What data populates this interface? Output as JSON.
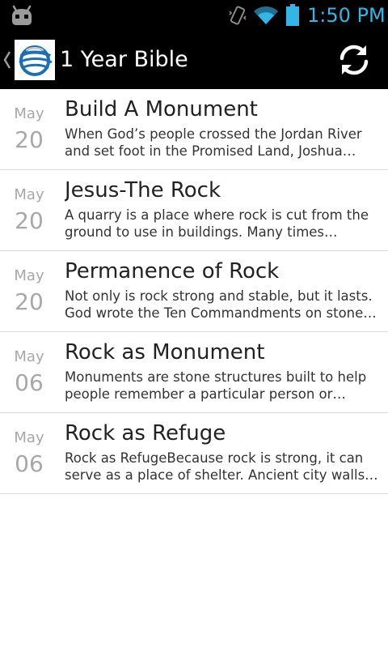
{
  "status_bar": {
    "time": "1:50 PM",
    "icons": [
      "cyanogenmod-robot-icon",
      "vibrate-icon",
      "wifi-icon",
      "battery-icon"
    ]
  },
  "action_bar": {
    "title": "1 Year Bible",
    "icons": [
      "up-caret-icon",
      "app-logo-icon",
      "refresh-icon"
    ]
  },
  "entries": [
    {
      "month": "May",
      "day": "20",
      "title": "Build A Monument",
      "summary": "When God’s people crossed the Jordan River and set foot in the Promised Land, Joshua asked…"
    },
    {
      "month": "May",
      "day": "20",
      "title": "Jesus-The Rock",
      "summary": "A quarry is a place where rock is cut from the ground to use in buildings. Many times building…"
    },
    {
      "month": "May",
      "day": "20",
      "title": "Permanence of Rock",
      "summary": "Not only is rock strong and stable, but it lasts. God wrote the Ten Commandments on stone…"
    },
    {
      "month": "May",
      "day": "06",
      "title": "Rock as Monument",
      "summary": "Monuments are stone structures built to help people remember a particular person or event.…"
    },
    {
      "month": "May",
      "day": "06",
      "title": "Rock as Refuge",
      "summary": "Rock as RefugeBecause rock is strong, it can serve as a place of shelter. Ancient city walls…"
    }
  ],
  "colors": {
    "status_accent": "#33b5e5",
    "bar_background": "#000000",
    "date_text": "#a8a8a8",
    "divider": "#dcdcdc",
    "logo_blue": "#1b6fb5"
  }
}
